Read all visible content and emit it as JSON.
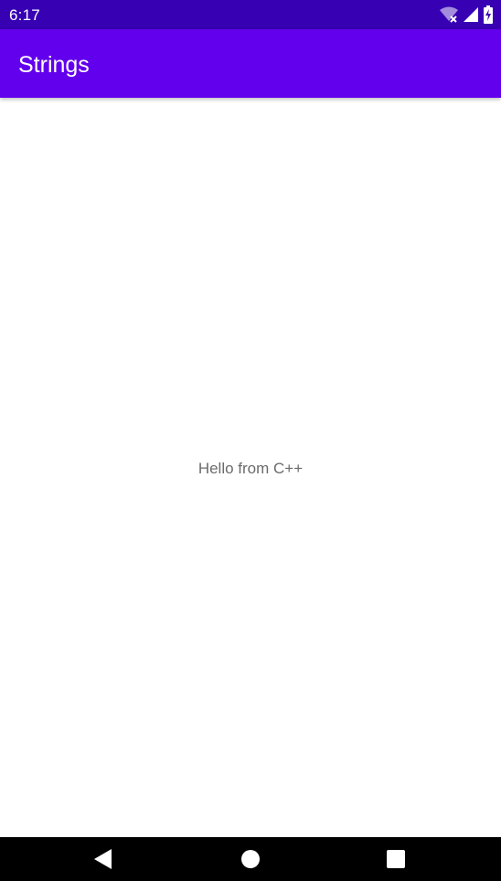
{
  "status_bar": {
    "time": "6:17",
    "icons": [
      "wifi-no-internet-icon",
      "cellular-signal-icon",
      "battery-charging-icon"
    ],
    "background": "#3700b3"
  },
  "app_bar": {
    "title": "Strings",
    "background": "#6200ee"
  },
  "main": {
    "message": "Hello from C++"
  },
  "nav_bar": {
    "icons": [
      "back-icon",
      "home-icon",
      "recents-icon"
    ]
  }
}
